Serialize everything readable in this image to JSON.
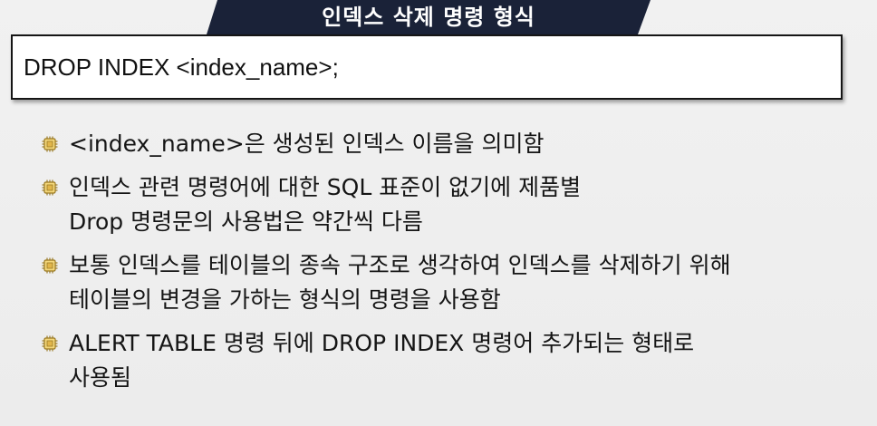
{
  "slide": {
    "title": "인덱스 삭제 명령 형식",
    "syntax": "DROP INDEX <index_name>;",
    "bullets": [
      {
        "lines": [
          "<index_name>은 생성된 인덱스 이름을 의미함"
        ]
      },
      {
        "lines": [
          "인덱스 관련 명령어에 대한 SQL 표준이 없기에 제품별",
          "Drop 명령문의 사용법은 약간씩 다름"
        ]
      },
      {
        "lines": [
          "보통 인덱스를 테이블의 종속 구조로 생각하여 인덱스를 삭제하기 위해",
          "테이블의 변경을 가하는 형식의 명령을 사용함"
        ]
      },
      {
        "lines": [
          "ALERT TABLE 명령 뒤에 DROP INDEX 명령어 추가되는 형태로",
          "사용됨"
        ]
      }
    ],
    "bullet_icon": "chip-icon",
    "colors": {
      "title_bar": "#1a2238",
      "bullet_icon": "#d4a73a"
    }
  }
}
